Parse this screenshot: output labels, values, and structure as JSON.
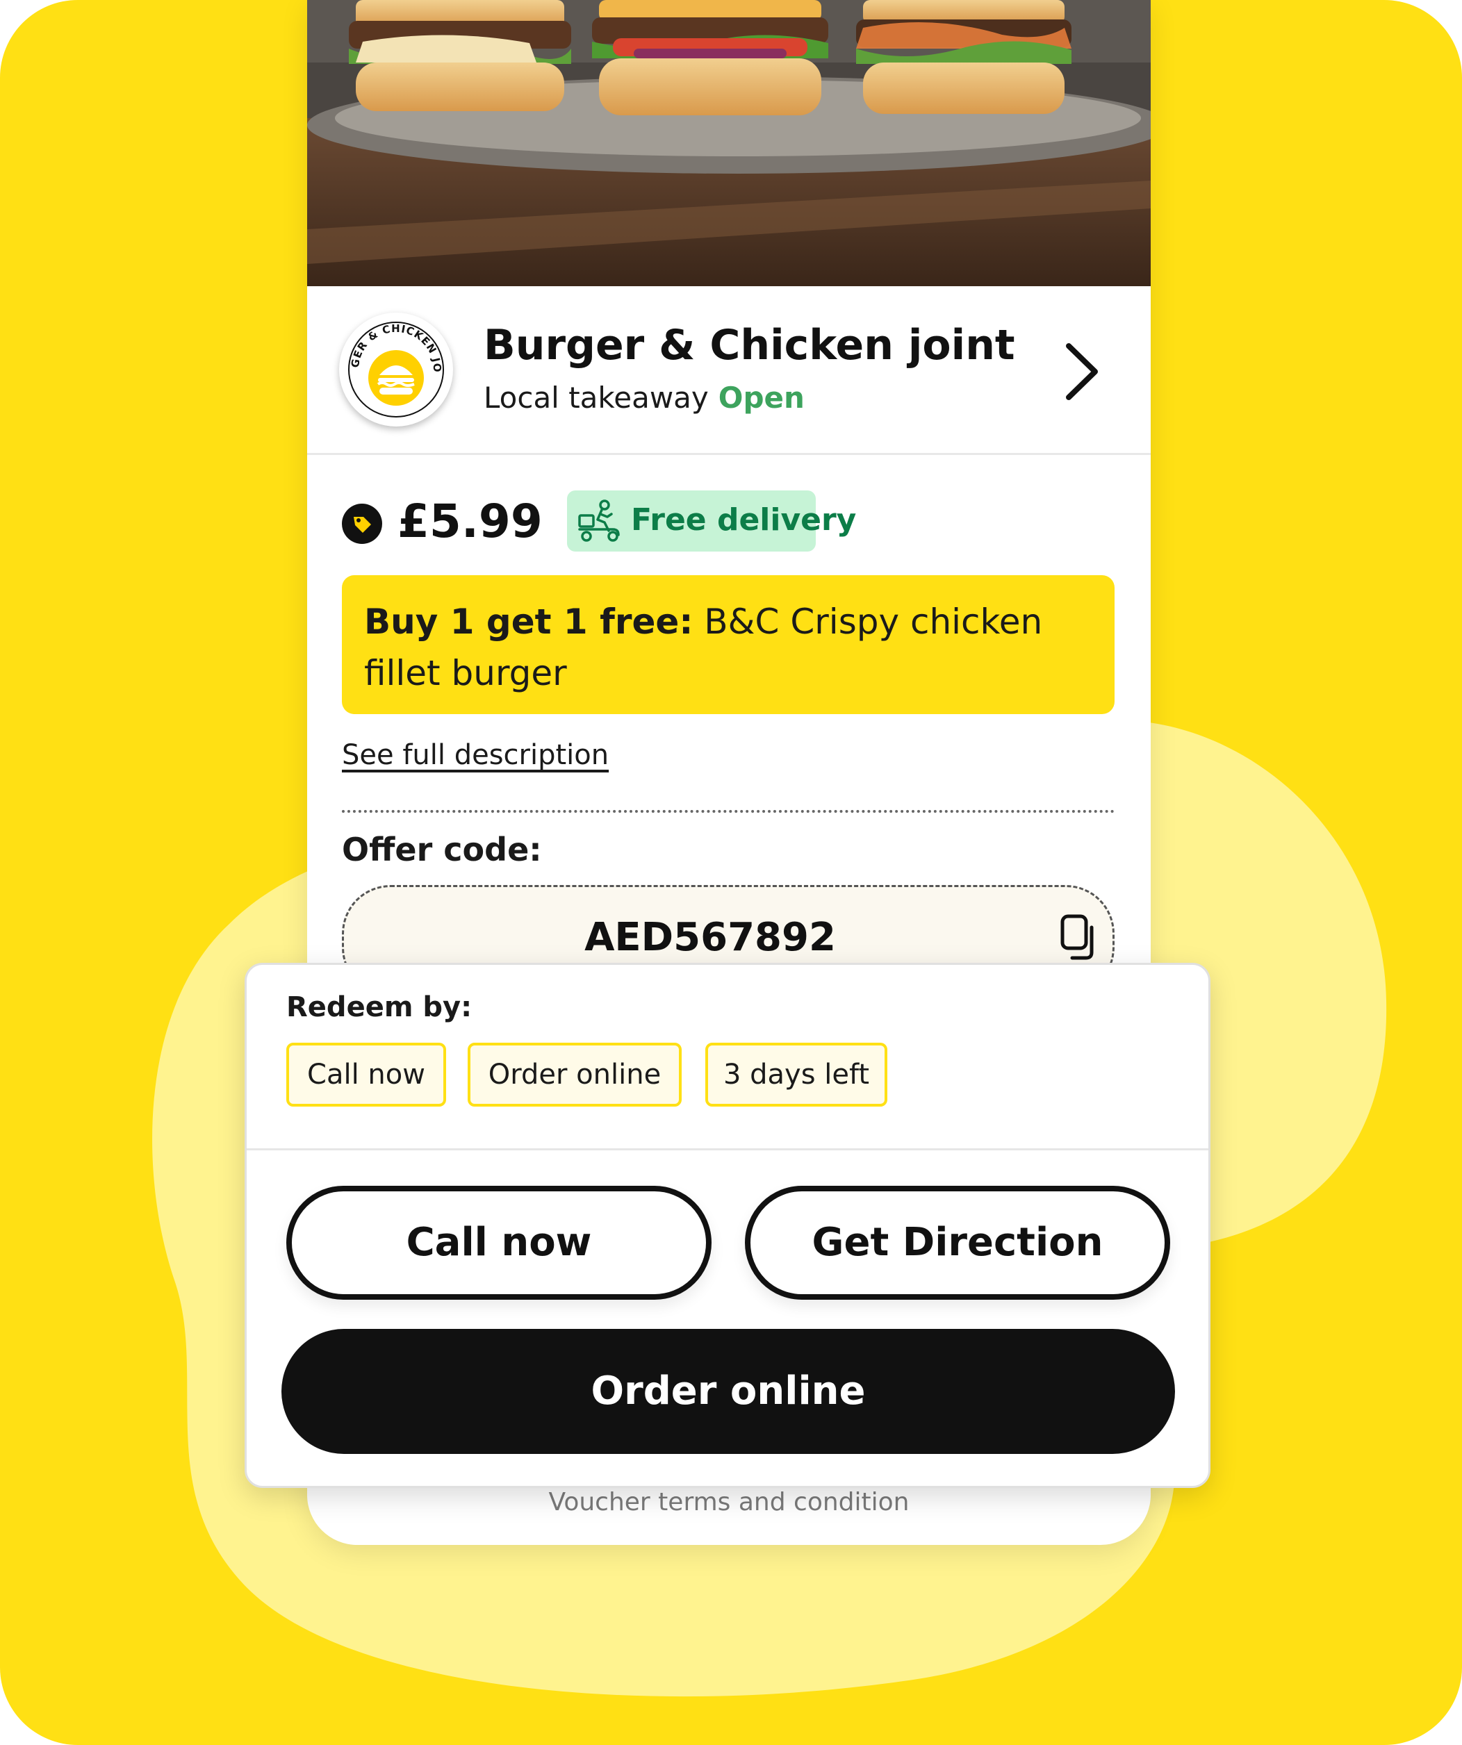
{
  "store": {
    "name": "Burger & Chicken joint",
    "category": "Local takeaway",
    "status": "Open",
    "logo_text": "BURGER & CHICKEN JOINT"
  },
  "offer": {
    "price": "£5.99",
    "delivery_label": "Free delivery",
    "promo_bold": "Buy 1 get 1 free:",
    "promo_text": " B&C Crispy chicken fillet burger",
    "see_description": "See full description",
    "code_label": "Offer code:",
    "code": "AED567892"
  },
  "redeem": {
    "label": "Redeem by:",
    "chips": [
      "Call now",
      "Order online",
      "3 days left"
    ]
  },
  "actions": {
    "call_now": "Call now",
    "get_direction": "Get Direction",
    "order_online": "Order online"
  },
  "footer": {
    "terms": "Voucher terms and condition"
  },
  "colors": {
    "brand_yellow": "#FFE014",
    "open_green": "#3DA35D",
    "delivery_bg": "#C6F3D6",
    "delivery_text": "#0C7D48",
    "dark": "#111111"
  },
  "icons": {
    "price": "price-tag-icon",
    "delivery": "delivery-scooter-icon",
    "chevron": "chevron-right-icon",
    "copy": "copy-icon"
  }
}
